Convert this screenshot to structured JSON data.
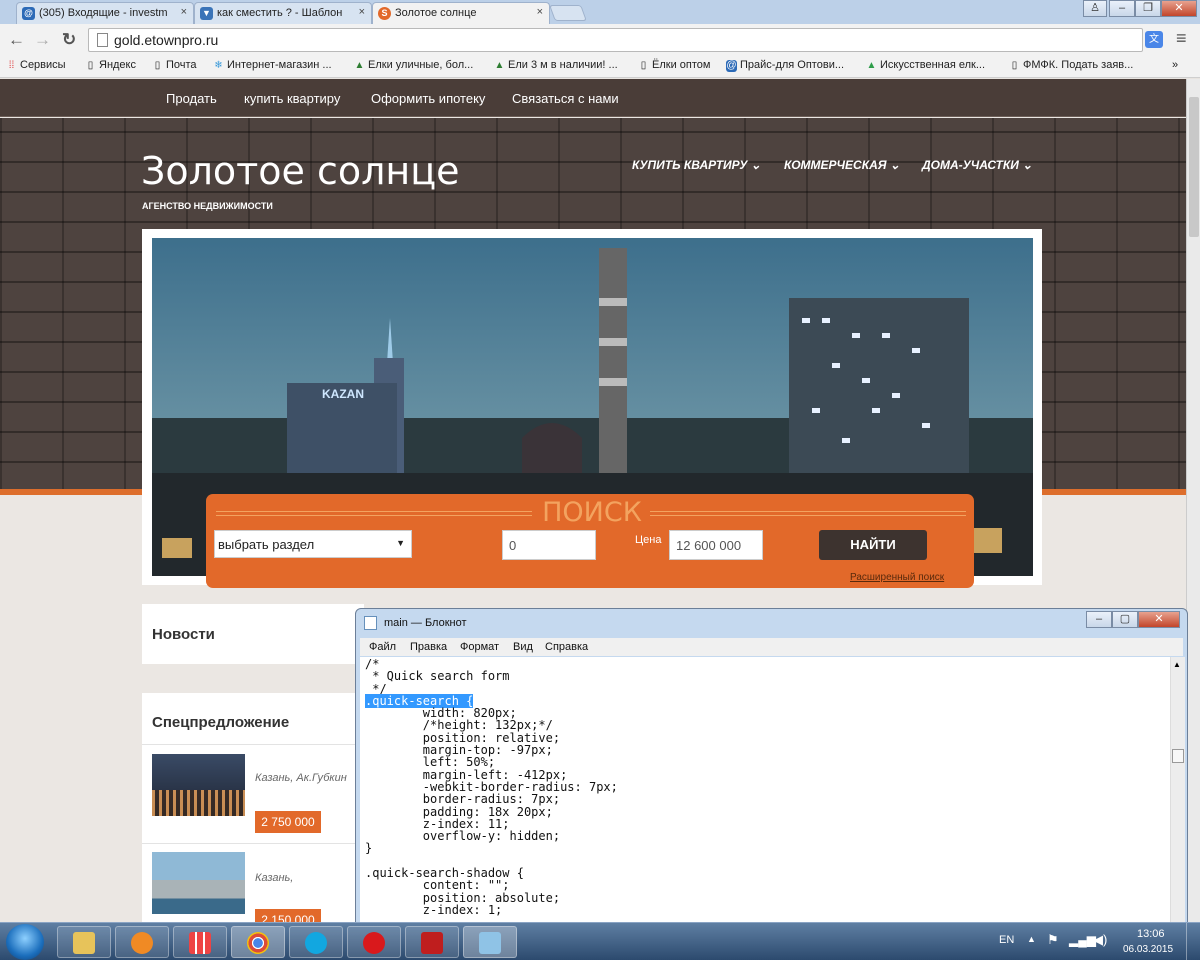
{
  "browser": {
    "tabs": [
      {
        "label": "(305) Входящие - investm",
        "icon": "mail-icon",
        "color": "#2c6ab7"
      },
      {
        "label": "как сместить ? - Шаблон",
        "icon": "forum-icon",
        "color": "#3b74b8"
      },
      {
        "label": "Золотое солнце",
        "icon": "site-s-icon",
        "color": "#e2692a"
      }
    ],
    "tab_close": "×",
    "url": "gold.etownpro.ru",
    "bookmarks": [
      "Сервисы",
      "Яндекс",
      "Почта",
      "Интернет-магазин ...",
      "Елки уличные, бол...",
      "Ели 3 м в наличии! ...",
      "Ёлки оптом",
      "Прайс-для Оптови...",
      "Искусственная елк...",
      "ФМФК. Подать заяв..."
    ],
    "more": "»"
  },
  "site": {
    "topnav": [
      "Продать",
      "купить квартиру",
      "Оформить ипотеку",
      "Связаться с нами"
    ],
    "title": "Золотое солнце",
    "subtitle": "АГЕНСТВО НЕДВИЖИМОСТИ",
    "mainmenu": [
      "КУПИТЬ КВАРТИРУ",
      "КОММЕРЧЕСКАЯ",
      "ДОМА-УЧАСТКИ"
    ],
    "hero_sign": "KAZAN",
    "search": {
      "title": "ПОИСК",
      "select_value": "выбрать раздел",
      "input1": "0",
      "price_label": "Цена",
      "input2": "12 600 000",
      "button": "НАЙТИ",
      "advanced": "Расширенный поиск"
    },
    "news_title": "Новости",
    "special_title": "Спецпредложение",
    "offers": [
      {
        "text": "Казань, Ак.Губкин",
        "price": "2 750 000"
      },
      {
        "text": "Казань,",
        "price": "2 150 000"
      }
    ]
  },
  "notepad": {
    "title": "main — Блокнот",
    "menu": [
      "Файл",
      "Правка",
      "Формат",
      "Вид",
      "Справка"
    ],
    "lines_before": "/*\n * Quick search form\n */",
    "selected": ".quick-search {",
    "lines_after": "\n\twidth: 820px;\n\t/*height: 132px;*/\n\tposition: relative;\n\tmargin-top: -97px;\n\tleft: 50%;\n\tmargin-left: -412px;\n\t-webkit-border-radius: 7px;\n\tborder-radius: 7px;\n\tpadding: 18x 20px;\n\tz-index: 11;\n\toverflow-y: hidden;\n}\n\n.quick-search-shadow {\n\tcontent: \"\";\n\tposition: absolute;\n\tz-index: 1;"
  },
  "taskbar": {
    "lang": "EN",
    "time": "13:06",
    "date": "06.03.2015",
    "apps": [
      "explorer",
      "media-player",
      "apps-grid",
      "chrome",
      "skype",
      "opera",
      "filezilla",
      "notepad"
    ]
  }
}
